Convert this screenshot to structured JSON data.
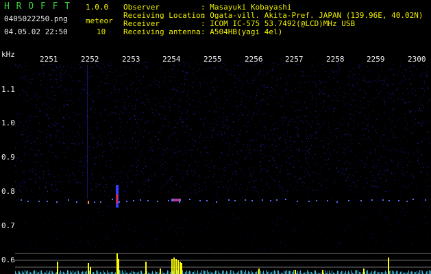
{
  "header": {
    "app_name": "H R O F F T",
    "app_version": "1.0.0",
    "file_name": "0405022250.png",
    "date_time": "04.05.02 22:50",
    "meteor_label": "meteor",
    "meteor_count": "10",
    "info": [
      {
        "label": "Observer",
        "value": ": Masayuki Kobayashi"
      },
      {
        "label": "Receiving Location",
        "value": ": Ogata-vill. Akita-Pref. JAPAN (139.96E, 40.02N)"
      },
      {
        "label": "Receiver",
        "value": ": ICOM IC-575 53.7492(@LCD)MHz USB"
      },
      {
        "label": "Receiving antenna",
        "value": ": A504HB(yagi 4el)"
      }
    ]
  },
  "axis": {
    "y_unit": "kHz",
    "y_ticks": [
      "1.1",
      "1.0",
      "0.9",
      "0.8",
      "0.7",
      "0.6"
    ],
    "x_ticks": [
      "2251",
      "2252",
      "2253",
      "2254",
      "2255",
      "2256",
      "2257",
      "2258",
      "2259",
      "2300"
    ]
  },
  "colors": {
    "background": "#000000",
    "noise": "#1a1a9a",
    "header_green": "#3cd23c",
    "header_yellow": "#f0f000",
    "meteor_peak": "#ff2020",
    "echo_bar": "#ffff00",
    "floor": "#40c0e0"
  }
}
